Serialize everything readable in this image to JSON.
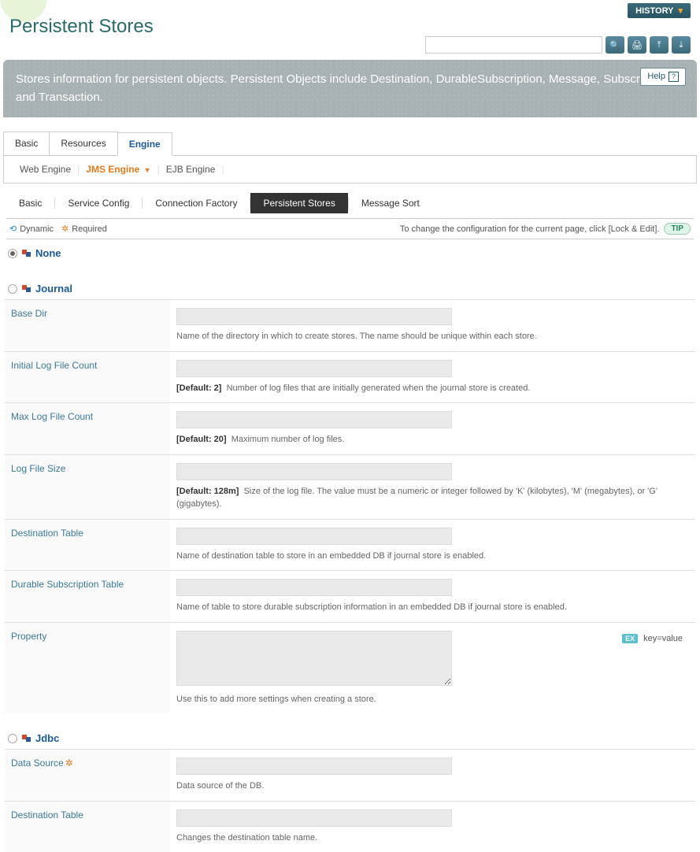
{
  "header": {
    "history_label": "HISTORY",
    "page_title": "Persistent Stores"
  },
  "search": {
    "value": ""
  },
  "banner": {
    "description": "Stores information for persistent objects. Persistent Objects include Destination, DurableSubscription, Message, Subscription, and Transaction.",
    "help_label": "Help"
  },
  "tabs_l1": {
    "items": [
      "Basic",
      "Resources",
      "Engine"
    ],
    "active": "Engine"
  },
  "tabs_l2": {
    "items": [
      "Web Engine",
      "JMS Engine",
      "EJB Engine"
    ],
    "active": "JMS Engine"
  },
  "tabs_l3": {
    "items": [
      "Basic",
      "Service Config",
      "Connection Factory",
      "Persistent Stores",
      "Message Sort"
    ],
    "active": "Persistent Stores"
  },
  "legend": {
    "dynamic": "Dynamic",
    "required": "Required",
    "tip_text": "To change the configuration for the current page, click [Lock & Edit].",
    "tip_badge": "TIP"
  },
  "sections": {
    "none": {
      "title": "None",
      "selected": true
    },
    "journal": {
      "title": "Journal",
      "selected": false,
      "fields": {
        "base_dir": {
          "label": "Base Dir",
          "value": "",
          "help": "Name of the directory in which to create stores. The name should be unique within each store."
        },
        "initial_log_file_count": {
          "label": "Initial Log File Count",
          "value": "",
          "default": "[Default: 2]",
          "help": "Number of log files that are initially generated when the journal store is created."
        },
        "max_log_file_count": {
          "label": "Max Log File Count",
          "value": "",
          "default": "[Default: 20]",
          "help": "Maximum number of log files."
        },
        "log_file_size": {
          "label": "Log File Size",
          "value": "",
          "default": "[Default: 128m]",
          "help": "Size of the log file. The value must be a numeric or integer followed by 'K' (kilobytes), 'M' (megabytes), or 'G' (gigabytes)."
        },
        "destination_table": {
          "label": "Destination Table",
          "value": "",
          "help": "Name of destination table to store in an embedded DB if journal store is enabled."
        },
        "durable_subscription_table": {
          "label": "Durable Subscription Table",
          "value": "",
          "help": "Name of table to store durable subscription information in an embedded DB if journal store is enabled."
        },
        "property": {
          "label": "Property",
          "value": "",
          "help": "Use this to add more settings when creating a store.",
          "ex_badge": "EX",
          "ex_text": "key=value"
        }
      }
    },
    "jdbc": {
      "title": "Jdbc",
      "selected": false,
      "fields": {
        "data_source": {
          "label": "Data Source",
          "required": true,
          "value": "",
          "help": "Data source of the DB."
        },
        "destination_table": {
          "label": "Destination Table",
          "value": "",
          "help": "Changes the destination table name."
        }
      }
    }
  }
}
